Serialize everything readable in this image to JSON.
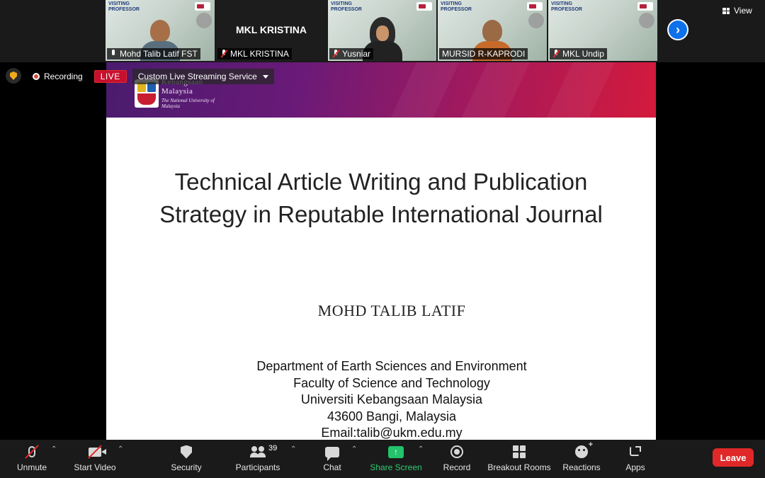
{
  "participants": [
    {
      "name": "Mohd Talib Latif FST",
      "muted": false,
      "type": "video"
    },
    {
      "name": "MKL KRISTINA",
      "muted": true,
      "type": "name-only"
    },
    {
      "name": "Yusniar",
      "muted": true,
      "type": "video"
    },
    {
      "name": "MURSID R-KAPRODI",
      "muted": false,
      "type": "video"
    },
    {
      "name": "MKL Undip",
      "muted": true,
      "type": "video"
    }
  ],
  "tile_poster_text": "VISITING\nPROFESSOR",
  "view_label": "View",
  "recording": {
    "label": "Recording",
    "live_badge": "LIVE",
    "stream_service": "Custom Live Streaming Service"
  },
  "slide": {
    "logo_lines": [
      "Kebangsaan",
      "Malaysia",
      "The National University of Malaysia"
    ],
    "title_line1": "Technical Article Writing and Publication",
    "title_line2": "Strategy in Reputable International Journal",
    "author": "MOHD TALIB LATIF",
    "affiliation": [
      "Department of Earth Sciences and Environment",
      "Faculty of Science and Technology",
      "Universiti Kebangsaan Malaysia",
      "43600 Bangi, Malaysia",
      "Email:talib@ukm.edu.my"
    ]
  },
  "toolbar": {
    "unmute": "Unmute",
    "start_video": "Start Video",
    "security": "Security",
    "participants": "Participants",
    "participants_count": "39",
    "chat": "Chat",
    "share_screen": "Share Screen",
    "record": "Record",
    "breakout_rooms": "Breakout Rooms",
    "reactions": "Reactions",
    "apps": "Apps",
    "leave": "Leave"
  },
  "colors": {
    "accent_blue": "#0e71eb",
    "leave_red": "#e02828",
    "share_green": "#23c26b",
    "live_red": "#c8102e",
    "banner_start": "#4a1b6e",
    "banner_end": "#d41a3c"
  },
  "icons": [
    "mic-muted-icon",
    "video-off-icon",
    "shield-icon",
    "participants-icon",
    "chat-icon",
    "share-arrow-icon",
    "record-icon",
    "breakout-grid-icon",
    "reaction-smile-icon",
    "apps-icon",
    "chevron-right-icon",
    "grid-view-icon"
  ]
}
